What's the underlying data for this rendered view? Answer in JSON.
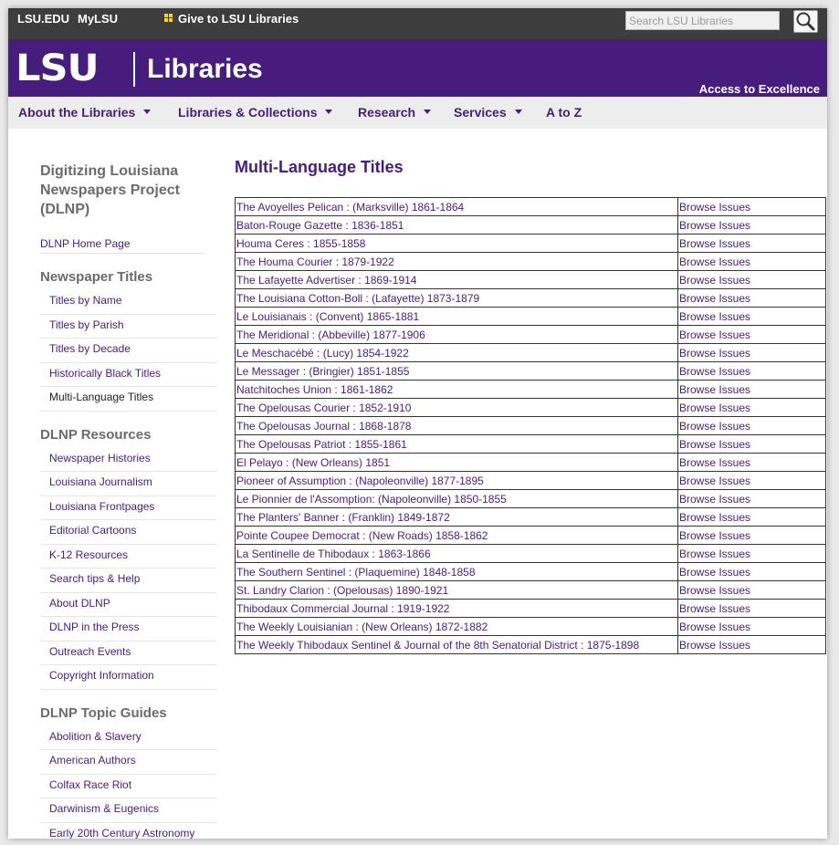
{
  "utility": {
    "lsu_edu": "LSU.EDU",
    "mylsu": "MyLSU",
    "give": "Give to LSU Libraries",
    "search_placeholder": "Search LSU Libraries"
  },
  "header": {
    "logo_lsu": "LSU",
    "logo_libraries": "Libraries",
    "tagline": "Access to Excellence"
  },
  "nav": {
    "items": [
      "About the Libraries",
      "Libraries & Collections",
      "Research",
      "Services",
      "A to Z"
    ]
  },
  "sidebar": {
    "title": "Digitizing Louisiana Newspapers Project (DLNP)",
    "home_link": "DLNP Home Page",
    "sections": [
      {
        "heading": "Newspaper Titles",
        "links": [
          "Titles by Name",
          "Titles by Parish",
          "Titles by Decade",
          "Historically Black Titles",
          "Multi-Language Titles"
        ]
      },
      {
        "heading": "DLNP Resources",
        "links": [
          "Newspaper Histories",
          "Louisiana Journalism",
          "Louisiana Frontpages",
          "Editorial Cartoons",
          "K-12 Resources",
          "Search tips & Help",
          "About DLNP",
          "DLNP in the Press",
          "Outreach Events",
          "Copyright Information"
        ]
      },
      {
        "heading": "DLNP Topic Guides",
        "links": [
          "Abolition & Slavery",
          "American Authors",
          "Colfax Race Riot",
          "Darwinism & Eugenics",
          "Early 20th Century Astronomy"
        ]
      }
    ]
  },
  "main": {
    "title": "Multi-Language Titles",
    "browse_label": "Browse Issues",
    "rows": [
      "The Avoyelles Pelican : (Marksville) 1861-1864",
      "Baton-Rouge Gazette : 1836-1851",
      "Houma Ceres : 1855-1858",
      "The Houma Courier : 1879-1922",
      "The Lafayette Advertiser : 1869-1914",
      "The Louisiana Cotton-Boll : (Lafayette) 1873-1879",
      "Le Louisianais : (Convent) 1865-1881",
      "The Meridional : (Abbeville) 1877-1906",
      "Le Meschacébé : (Lucy) 1854-1922",
      "Le Messager : (Bringier) 1851-1855",
      "Natchitoches Union : 1861-1862",
      "The Opelousas Courier : 1852-1910",
      "The Opelousas Journal : 1868-1878",
      "The Opelousas Patriot : 1855-1861",
      "El Pelayo : (New Orleans) 1851",
      "Pioneer of Assumption : (Napoleonville) 1877-1895",
      "Le Pionnier de l'Assomption: (Napoleonville) 1850-1855",
      "The Planters' Banner : (Franklin) 1849-1872",
      "Pointe Coupee Democrat : (New Roads) 1858-1862",
      "La Sentinelle de Thibodaux : 1863-1866",
      "The Southern Sentinel : (Plaquemine) 1848-1858",
      "St. Landry Clarion : (Opelousas) 1890-1921",
      "Thibodaux Commercial Journal : 1919-1922",
      "The Weekly Louisianian : (New Orleans) 1872-1882",
      "The Weekly Thibodaux Sentinel & Journal of the 8th Senatorial District : 1875-1898"
    ]
  },
  "colors": {
    "lsu_purple": "#461d7c",
    "lsu_gold": "#fdd023",
    "utility_bar": "#3d3d3d",
    "nav_bar": "#ededed"
  },
  "icons": [
    "gift-icon",
    "search-icon",
    "chevron-down-icon"
  ]
}
